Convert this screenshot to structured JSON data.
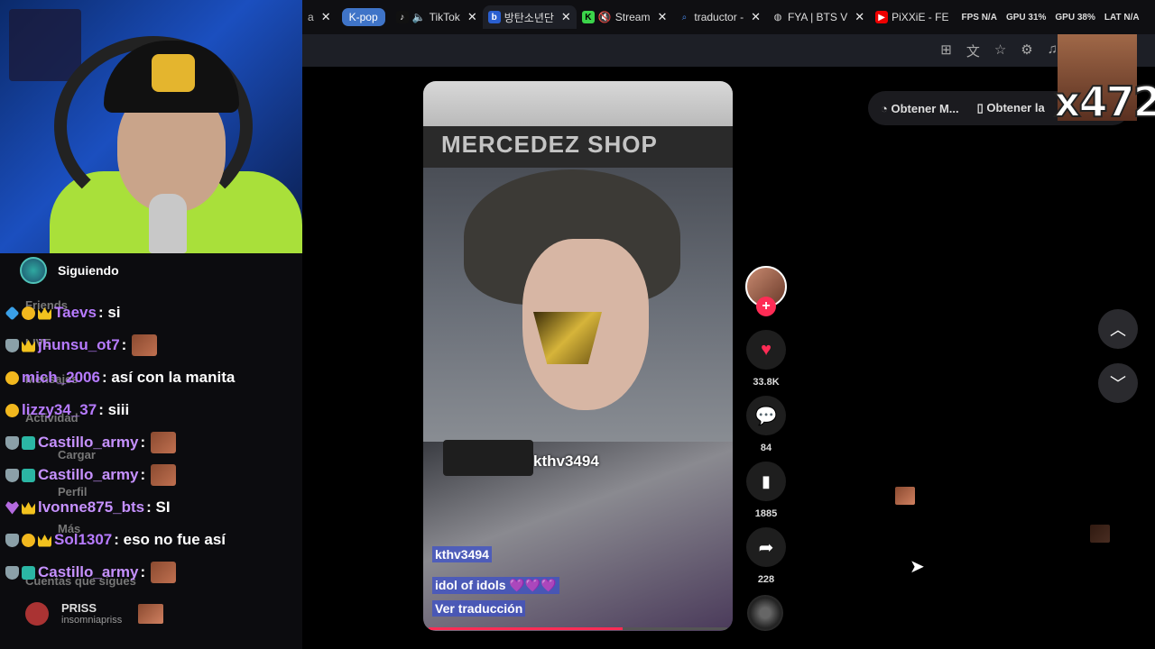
{
  "browser": {
    "tabs": [
      {
        "label": "K-pop",
        "style": "pill"
      },
      {
        "label": "TikTok",
        "icon": "tiktok-icon"
      },
      {
        "label": "방탄소년단",
        "icon": "bts-icon",
        "active": true
      },
      {
        "label": "Stream",
        "icon": "kick-icon"
      },
      {
        "label": "traductor -",
        "icon": "search-icon"
      },
      {
        "label": "FYA | BTS V",
        "icon": "globe-icon"
      },
      {
        "label": "PiXXiE - FE",
        "icon": "youtube-icon"
      }
    ],
    "stats": {
      "fps": "FPS N/A",
      "gpu": "GPU 31%",
      "gpu2": "GPU 38%",
      "lat": "LAT N/A"
    }
  },
  "sidebar": {
    "following_label": "Siguiendo",
    "ghost_items": [
      "Friends",
      "LIVE",
      "Mensajes",
      "Actividad",
      "Cargar",
      "Perfil",
      "Más",
      "Cuentas que sigues"
    ],
    "account": {
      "name": "PRISS",
      "handle": "insomniapriss"
    }
  },
  "chat": [
    {
      "user": "Taevs",
      "text": ": si",
      "badges": [
        "cube",
        "one",
        "crown"
      ]
    },
    {
      "user": "jhunsu_ot7",
      "text": ":",
      "badges": [
        "shield",
        "crown"
      ],
      "emote": true
    },
    {
      "user": "mich_2006",
      "text": ": así con la manita",
      "badges": [
        "emoji"
      ]
    },
    {
      "user": "lizzy34_37",
      "text": ": siii",
      "badges": [
        "emoji"
      ]
    },
    {
      "user": "Castillo_army",
      "text": ":",
      "badges": [
        "shield",
        "gg"
      ],
      "emote": true
    },
    {
      "user": "Castillo_army",
      "text": ":",
      "badges": [
        "shield",
        "gg"
      ],
      "emote": true
    },
    {
      "user": "lvonne875_bts",
      "text": ": SI",
      "badges": [
        "heart",
        "crown"
      ]
    },
    {
      "user": "Sol1307",
      "text": ": eso no fue así",
      "badges": [
        "shield",
        "one",
        "crown"
      ]
    },
    {
      "user": "Castillo_army",
      "text": ":",
      "badges": [
        "shield",
        "gg"
      ],
      "emote": true
    }
  ],
  "video": {
    "stage_text": "MERCEDEZ SHOP",
    "overlay_handle": "kthv3494",
    "author": "kthv3494",
    "description": "idol of idols 💜💜💜",
    "translate": "Ver traducción",
    "progress": 0.65
  },
  "actions": {
    "likes": "33.8K",
    "comments": "84",
    "saves": "1885",
    "shares": "228"
  },
  "get_bar": {
    "item1": "Obtener M...",
    "item2": "Obtener la"
  },
  "overlay": {
    "multiplier": "x472"
  }
}
